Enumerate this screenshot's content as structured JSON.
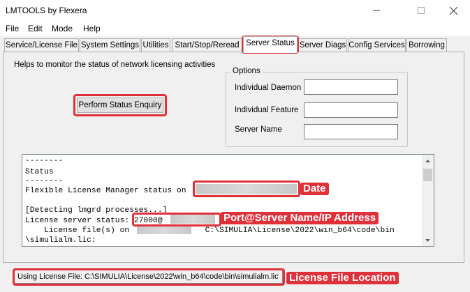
{
  "window": {
    "title": "LMTOOLS by Flexera"
  },
  "menu": [
    "File",
    "Edit",
    "Mode",
    "Help"
  ],
  "tabs": [
    "Service/License File",
    "System Settings",
    "Utilities",
    "Start/Stop/Reread",
    "Server Status",
    "Server Diags",
    "Config Services",
    "Borrowing"
  ],
  "active_tab": "Server Status",
  "server_status": {
    "help_text": "Helps to monitor the status of network licensing activities",
    "perform_button": "Perform Status Enquiry",
    "options": {
      "legend": "Options",
      "individual_daemon_label": "Individual Daemon",
      "individual_feature_label": "Individual Feature",
      "server_name_label": "Server Name",
      "individual_daemon_value": "",
      "individual_feature_value": "",
      "server_name_value": ""
    },
    "output_lines": [
      "--------",
      "Status",
      "--------",
      "Flexible License Manager status on",
      "",
      "[Detecting lmgrd processes...]",
      "License server status: 27000@",
      "    License file(s) on                C:\\SIMULIA\\License\\2022\\win_b64\\code\\bin",
      "\\simulialm.lic:"
    ]
  },
  "status_bar": {
    "text": "Using License File:  C:\\SIMULIA\\License\\2022\\win_b64\\code\\bin\\simulialm.lic"
  },
  "annotations": {
    "date": "Date",
    "port": "Port@Server Name/IP Address",
    "license_location": "License File Location"
  },
  "colors": {
    "highlight": "#e0303a",
    "window_bg": "#f0f0f0"
  }
}
